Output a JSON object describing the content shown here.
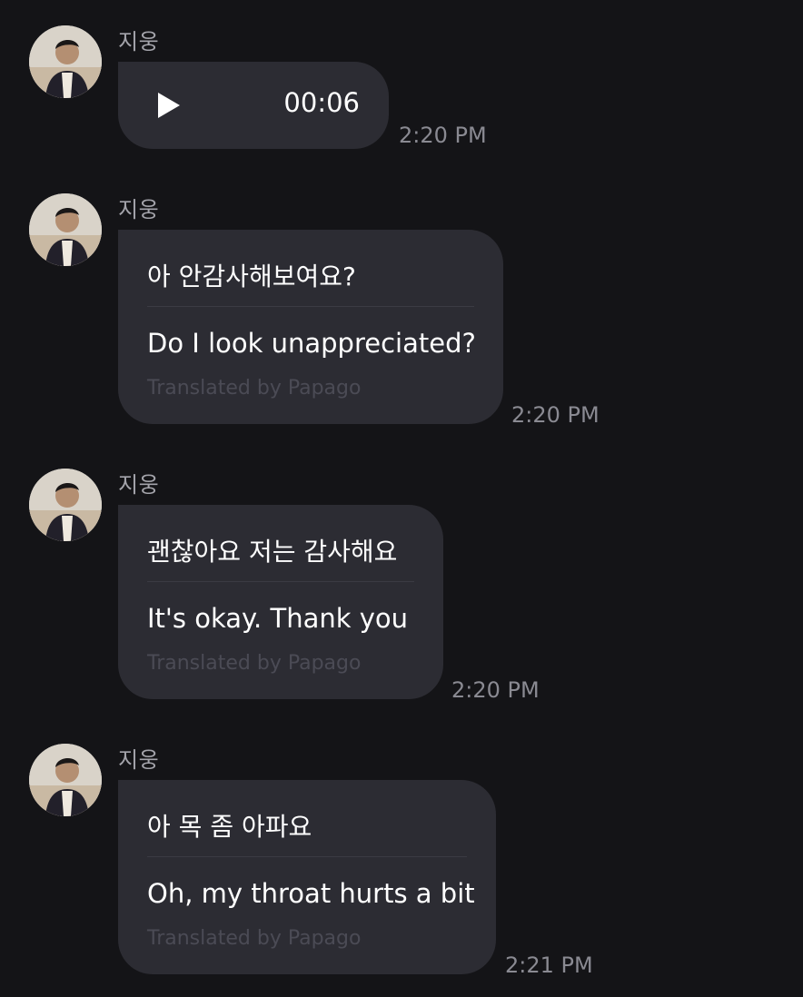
{
  "messages": [
    {
      "sender": "지웅",
      "type": "voice",
      "duration": "00:06",
      "time": "2:20 PM"
    },
    {
      "sender": "지웅",
      "type": "text",
      "original": "아 안감사해보여요?",
      "translation": "Do I look unappreciated?",
      "credit": "Translated by Papago",
      "time": "2:20 PM"
    },
    {
      "sender": "지웅",
      "type": "text",
      "original": "괜찮아요 저는 감사해요",
      "translation": "It's okay. Thank you",
      "credit": "Translated by Papago",
      "time": "2:20 PM"
    },
    {
      "sender": "지웅",
      "type": "text",
      "original": "아 목 좀 아파요",
      "translation": "Oh, my throat hurts a bit",
      "credit": "Translated by Papago",
      "time": "2:21 PM"
    }
  ],
  "colors": {
    "background": "#141417",
    "bubble": "#2c2c33",
    "sender_text": "#a4a4ab",
    "timestamp_text": "#8a8a92",
    "credit_text": "#4b4b55"
  },
  "icons": {
    "play": "play-icon"
  }
}
